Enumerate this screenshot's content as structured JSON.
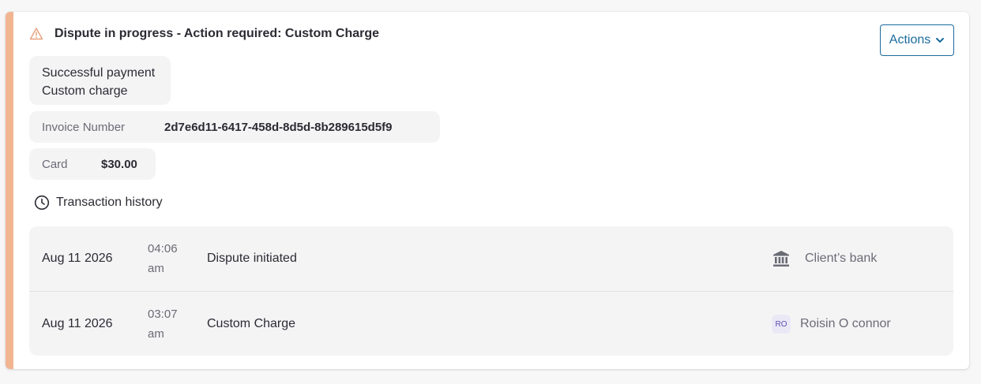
{
  "alert": {
    "title": "Dispute in progress - Action required: Custom Charge",
    "icon": "warning-triangle-icon",
    "accent_color": "#f1b592"
  },
  "actions_button": {
    "label": "Actions",
    "icon": "chevron-down-icon",
    "color": "#1a6b9e"
  },
  "payment": {
    "status": "Successful payment",
    "type": "Custom charge"
  },
  "invoice": {
    "label": "Invoice Number",
    "value": "2d7e6d11-6417-458d-8d5d-8b289615d5f9"
  },
  "card": {
    "label": "Card",
    "amount": "$30.00"
  },
  "history": {
    "title": "Transaction history",
    "icon": "clock-icon",
    "rows": [
      {
        "date": "Aug 11 2026",
        "time": "04:06am",
        "event": "Dispute initiated",
        "actor": "Client’s bank",
        "actor_icon": "bank-icon"
      },
      {
        "date": "Aug 11 2026",
        "time": "03:07am",
        "event": "Custom Charge",
        "actor": "Roisin O connor",
        "actor_initials": "RO"
      }
    ]
  }
}
